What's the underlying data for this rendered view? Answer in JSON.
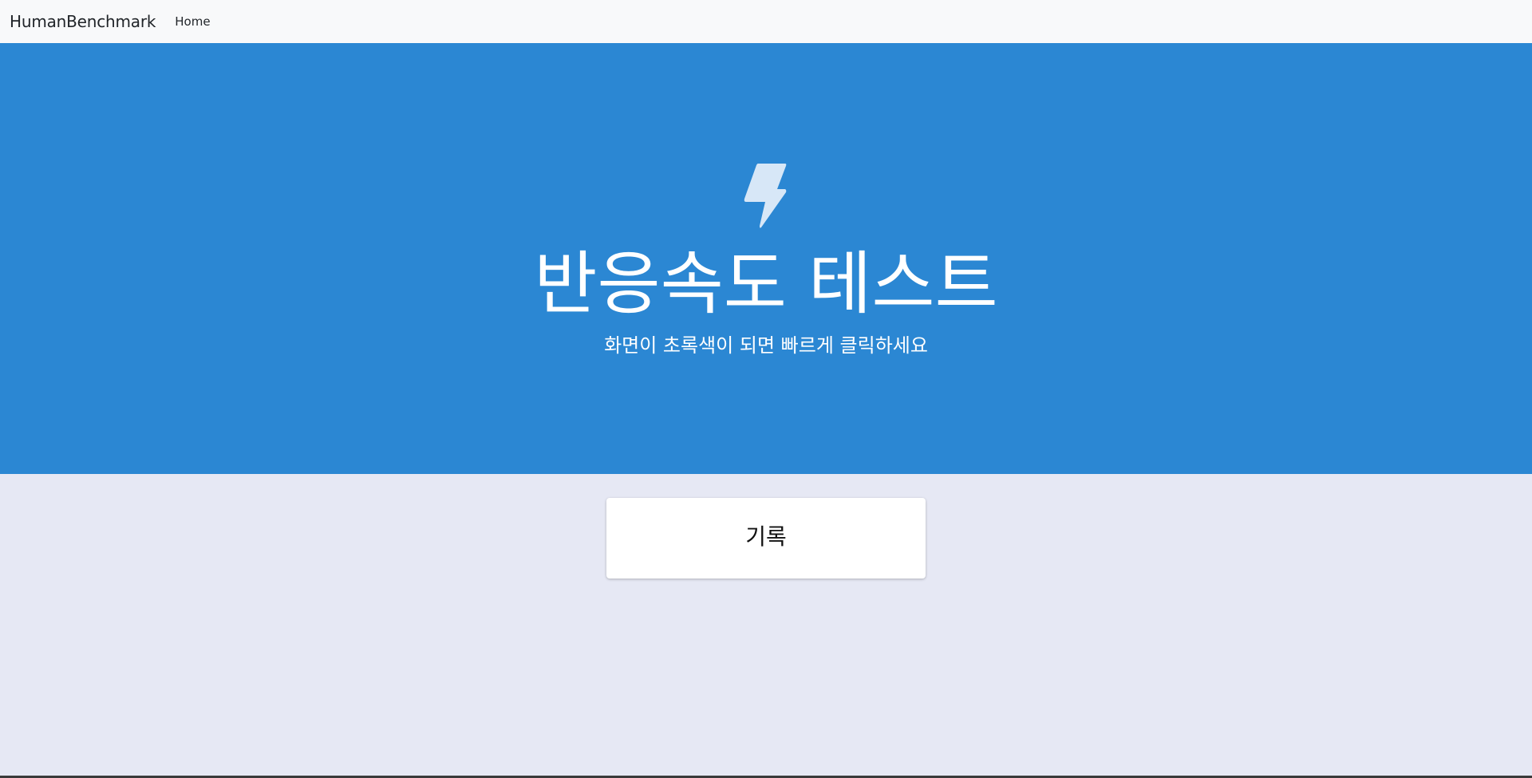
{
  "navbar": {
    "brand": "HumanBenchmark",
    "links": [
      {
        "label": "Home"
      }
    ]
  },
  "hero": {
    "icon": "lightning-bolt-icon",
    "title": "반응속도 테스트",
    "subtitle": "화면이 초록색이 되면 빠르게 클릭하세요"
  },
  "record_card": {
    "label": "기록"
  },
  "colors": {
    "hero_background": "#2b87d3",
    "page_background": "#e6e8f4",
    "navbar_background": "#f8f9fa",
    "icon_fill": "#d7e7f7"
  }
}
